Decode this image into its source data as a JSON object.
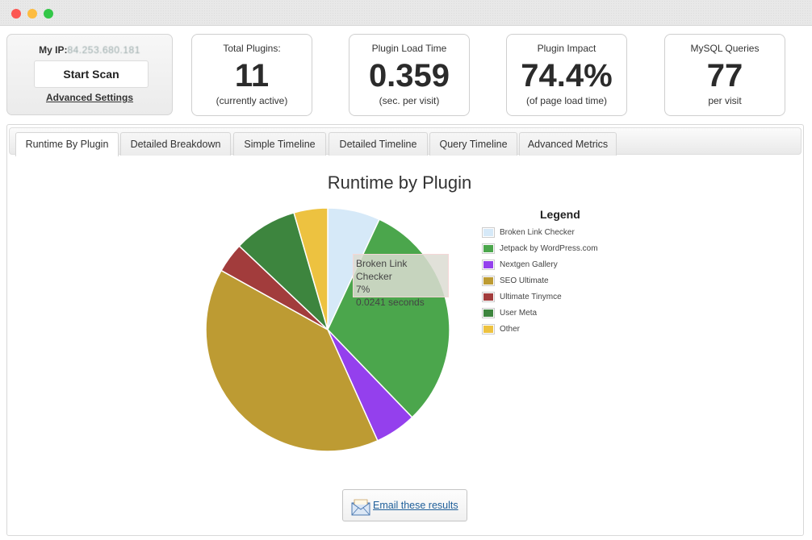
{
  "window": {
    "controls": [
      "close",
      "minimize",
      "maximize"
    ]
  },
  "scan_box": {
    "ip_label": "My IP:",
    "ip_value": "84.253.680.181",
    "start_scan_label": "Start Scan",
    "advanced_settings_label": "Advanced Settings"
  },
  "stats": [
    {
      "label": "Total Plugins:",
      "value": "11",
      "sub": "(currently active)"
    },
    {
      "label": "Plugin Load Time",
      "value": "0.359",
      "sub": "(sec. per visit)"
    },
    {
      "label": "Plugin Impact",
      "value": "74.4%",
      "sub": "(of page load time)"
    },
    {
      "label": "MySQL Queries",
      "value": "77",
      "sub": "per visit"
    }
  ],
  "tabs": [
    {
      "label": "Runtime By Plugin",
      "active": true
    },
    {
      "label": "Detailed Breakdown",
      "active": false
    },
    {
      "label": "Simple Timeline",
      "active": false
    },
    {
      "label": "Detailed Timeline",
      "active": false
    },
    {
      "label": "Query Timeline",
      "active": false
    },
    {
      "label": "Advanced Metrics",
      "active": false
    }
  ],
  "chart_data": {
    "type": "pie",
    "title": "Runtime by Plugin",
    "legend_title": "Legend",
    "legend_position": "right",
    "unit": "percent",
    "slices": [
      {
        "label": "Broken Link Checker",
        "value": 7,
        "color": "#d6e9f8"
      },
      {
        "label": "Jetpack by WordPress.com",
        "value": 31,
        "color": "#4ba64c"
      },
      {
        "label": "Nextgen Gallery",
        "value": 5.5,
        "color": "#9440ed"
      },
      {
        "label": "SEO Ultimate",
        "value": 40,
        "color": "#bd9b33"
      },
      {
        "label": "Ultimate Tinymce",
        "value": 4,
        "color": "#a23c3c"
      },
      {
        "label": "User Meta",
        "value": 8.5,
        "color": "#3d853e"
      },
      {
        "label": "Other",
        "value": 4.5,
        "color": "#edc240"
      }
    ],
    "tooltip": {
      "line1": "Broken Link Checker",
      "line2": "7%",
      "line3": "0.0241 seconds"
    }
  },
  "email": {
    "label": "Email these results"
  }
}
